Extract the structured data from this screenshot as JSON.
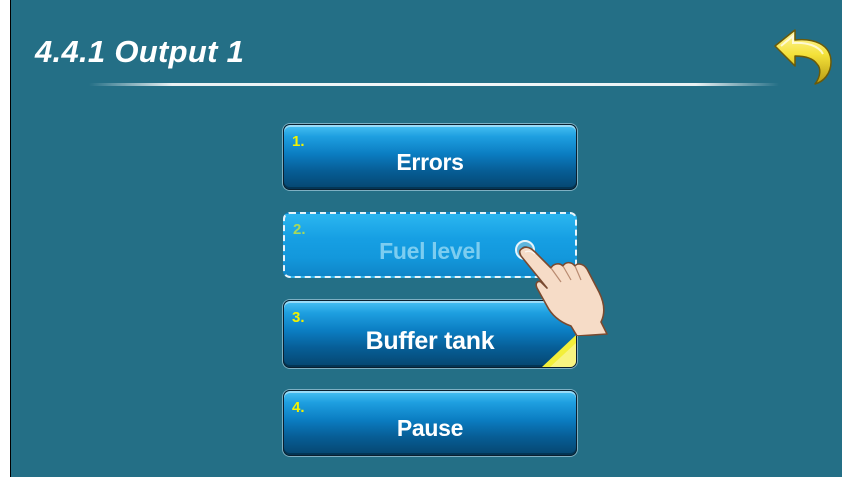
{
  "header": {
    "title": "4.4.1 Output 1"
  },
  "icons": {
    "back": "back-arrow-icon",
    "cursor": "hand-pointer-icon"
  },
  "menu": {
    "items": [
      {
        "number": "1.",
        "label": "Errors",
        "state": "normal"
      },
      {
        "number": "2.",
        "label": "Fuel level",
        "state": "selected"
      },
      {
        "number": "3.",
        "label": "Buffer tank",
        "state": "active"
      },
      {
        "number": "4.",
        "label": "Pause",
        "state": "normal"
      }
    ]
  },
  "colors": {
    "background": "#246f86",
    "number_accent": "#f2f200",
    "button_blue": "#0b7dc2",
    "back_arrow": "#f2e03a"
  }
}
